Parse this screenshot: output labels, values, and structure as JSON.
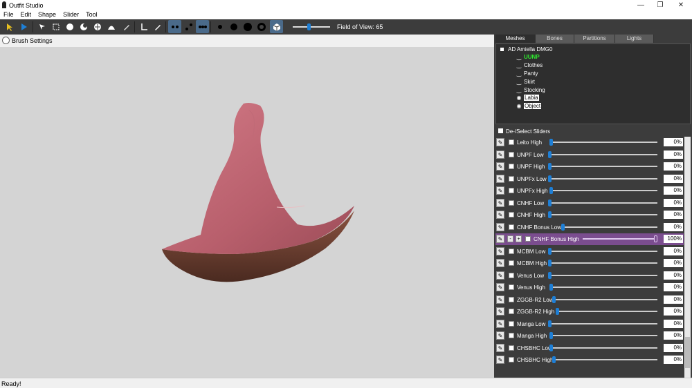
{
  "window": {
    "title": "Outfit Studio",
    "minimize": "—",
    "restore": "❐",
    "close": "✕"
  },
  "menu": [
    "File",
    "Edit",
    "Shape",
    "Slider",
    "Tool"
  ],
  "toolbar": {
    "fov_label": "Field of View: 65"
  },
  "brush": {
    "label": "Brush Settings"
  },
  "tabs": [
    "Meshes",
    "Bones",
    "Partitions",
    "Lights"
  ],
  "tree": {
    "root": "AD Amiella DMG0",
    "items": [
      "UUNP",
      "Clothes",
      "Panty",
      "Skirt",
      "Stocking",
      "Labia",
      "Object"
    ]
  },
  "sliders_header": "De-/Select Sliders",
  "sliders": [
    {
      "name": "Leito High",
      "value": "0%"
    },
    {
      "name": "UNPF Low",
      "value": "0%"
    },
    {
      "name": "UNPF High",
      "value": "0%"
    },
    {
      "name": "UNPFx Low",
      "value": "0%"
    },
    {
      "name": "UNPFx High",
      "value": "0%"
    },
    {
      "name": "CNHF Low",
      "value": "0%"
    },
    {
      "name": "CNHF High",
      "value": "0%"
    },
    {
      "name": "CNHF Bonus Low",
      "value": "0%"
    },
    {
      "name": "CNHF Bonus High",
      "value": "100%"
    },
    {
      "name": "MCBM Low",
      "value": "0%"
    },
    {
      "name": "MCBM High",
      "value": "0%"
    },
    {
      "name": "Venus Low",
      "value": "0%"
    },
    {
      "name": "Venus High",
      "value": "0%"
    },
    {
      "name": "ZGGB-R2 Low",
      "value": "0%"
    },
    {
      "name": "ZGGB-R2 High",
      "value": "0%"
    },
    {
      "name": "Manga Low",
      "value": "0%"
    },
    {
      "name": "Manga High",
      "value": "0%"
    },
    {
      "name": "CHSBHC Low",
      "value": "0%"
    },
    {
      "name": "CHSBHC High",
      "value": "0%"
    }
  ],
  "status": "Ready!"
}
